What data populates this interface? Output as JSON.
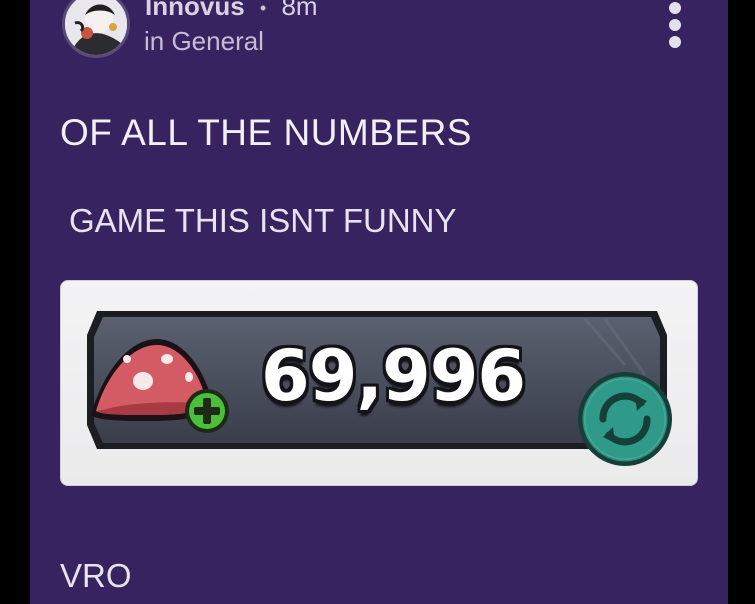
{
  "post": {
    "author": "Innovus",
    "separator": "•",
    "time_ago": "8m",
    "category": "in General",
    "title": "OF ALL THE NUMBERS",
    "body": "GAME THIS ISNT FUNNY",
    "comment": "VRO"
  },
  "embedded_image": {
    "currency_amount": "69,996",
    "icons": [
      "mushroom-icon",
      "plus-icon",
      "refresh-icon"
    ]
  },
  "icons": {
    "menu": "more-vertical-icon",
    "avatar": "user-avatar"
  },
  "colors": {
    "background": "#36235f",
    "text": "#f2eff7",
    "subtext": "#c5bdd6",
    "panel": "#4a4f5e",
    "plus_green": "#4cbf3a",
    "refresh_teal": "#2f9a89",
    "mushroom_red": "#d45b63"
  }
}
